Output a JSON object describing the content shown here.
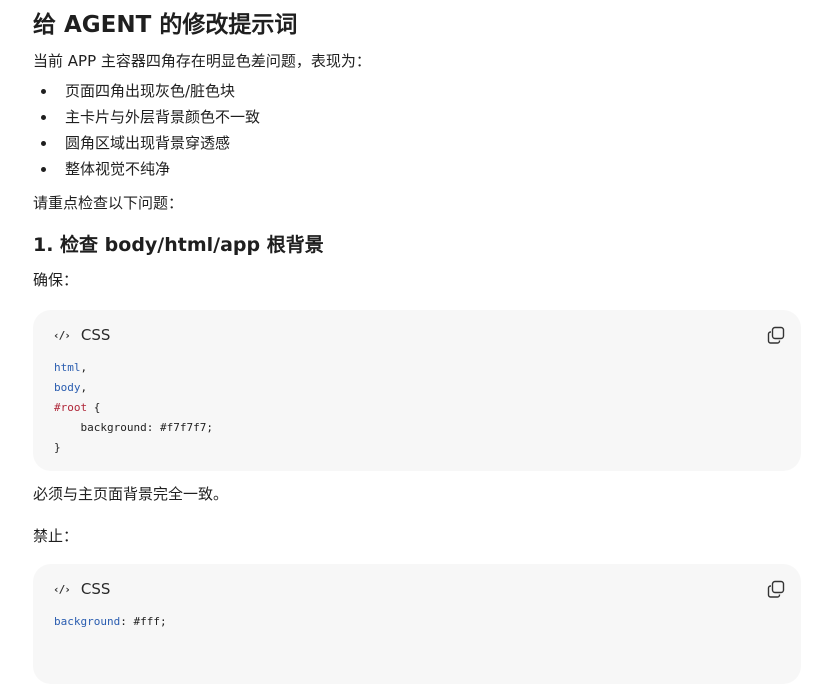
{
  "doc": {
    "title": "给 AGENT 的修改提示词",
    "intro": "当前 APP 主容器四角存在明显色差问题，表现为：",
    "bullets": [
      "页面四角出现灰色/脏色块",
      "主卡片与外层背景颜色不一致",
      "圆角区域出现背景穿透感",
      "整体视觉不纯净"
    ],
    "check_intro": "请重点检查以下问题：",
    "section1_title": "1. 检查 body/html/app 根背景",
    "ensure_label": "确保：",
    "after_code1": "必须与主页面背景完全一致。",
    "forbid_label": "禁止："
  },
  "code_blocks": [
    {
      "lang": "CSS",
      "lines": [
        [
          {
            "t": "sel",
            "v": "html"
          },
          {
            "t": "plain",
            "v": ","
          }
        ],
        [
          {
            "t": "sel",
            "v": "body"
          },
          {
            "t": "plain",
            "v": ","
          }
        ],
        [
          {
            "t": "id",
            "v": "#root"
          },
          {
            "t": "plain",
            "v": " {"
          }
        ],
        [
          {
            "t": "plain",
            "v": "    background: #f7f7f7;"
          }
        ],
        [
          {
            "t": "plain",
            "v": "}"
          }
        ]
      ]
    },
    {
      "lang": "CSS",
      "lines": [
        [
          {
            "t": "sel",
            "v": "background"
          },
          {
            "t": "plain",
            "v": ": #fff;"
          }
        ]
      ]
    }
  ],
  "icons": {
    "code": "code-brackets-icon",
    "copy": "copy-icon"
  },
  "colors": {
    "code_bg": "#f7f7f7",
    "selector": "#2a5db0",
    "id_selector": "#b0283a"
  }
}
